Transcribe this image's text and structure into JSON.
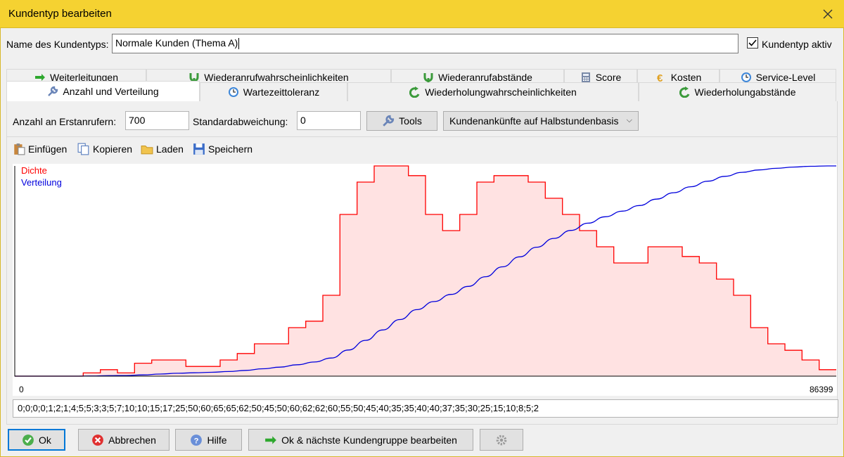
{
  "window": {
    "title": "Kundentyp bearbeiten"
  },
  "name_row": {
    "label": "Name des Kundentyps:",
    "value": "Normale Kunden (Thema A)",
    "active_label": "Kundentyp aktiv",
    "active_checked": true
  },
  "tabs_row1": [
    {
      "label": "Weiterleitungen",
      "icon": "arrow-right-icon"
    },
    {
      "label": "Wiederanrufwahrscheinlichkeiten",
      "icon": "recall-icon"
    },
    {
      "label": "Wiederanrufabstände",
      "icon": "recall-icon"
    },
    {
      "label": "Score",
      "icon": "calculator-icon"
    },
    {
      "label": "Kosten",
      "icon": "euro-icon"
    },
    {
      "label": "Service-Level",
      "icon": "clock-icon"
    }
  ],
  "tabs_row2": [
    {
      "label": "Anzahl und Verteilung",
      "icon": "wrench-icon",
      "active": true
    },
    {
      "label": "Wartezeittoleranz",
      "icon": "clock-icon"
    },
    {
      "label": "Wiederholungwahrscheinlichkeiten",
      "icon": "retry-icon"
    },
    {
      "label": "Wiederholungabstände",
      "icon": "retry-icon"
    }
  ],
  "toolbar": {
    "callers_label": "Anzahl an Erstanrufern:",
    "callers_value": "700",
    "std_label": "Standardabweichung:",
    "std_value": "0",
    "tools_label": "Tools",
    "mode_value": "Kundenankünfte auf Halbstundenbasis"
  },
  "iconbar": {
    "paste": "Einfügen",
    "copy": "Kopieren",
    "load": "Laden",
    "save": "Speichern"
  },
  "chart_data": {
    "type": "area",
    "legend": [
      "Dichte",
      "Verteilung"
    ],
    "x_min_label": "0",
    "x_max_label": "86399",
    "values": [
      0,
      0,
      0,
      0,
      1,
      2,
      1,
      4,
      5,
      5,
      3,
      3,
      5,
      7,
      10,
      10,
      15,
      17,
      25,
      50,
      60,
      65,
      65,
      62,
      50,
      45,
      50,
      60,
      62,
      62,
      60,
      55,
      50,
      45,
      40,
      35,
      35,
      40,
      40,
      37,
      35,
      30,
      25,
      15,
      10,
      8,
      5,
      2
    ],
    "series_colors": {
      "density": "#ff0000",
      "density_fill": "#ffe2e2",
      "distribution": "#0000dd"
    }
  },
  "values_text": "0;0;0;0;1;2;1;4;5;5;3;3;5;7;10;10;15;17;25;50;60;65;65;62;50;45;50;60;62;62;60;55;50;45;40;35;35;40;40;37;35;30;25;15;10;8;5;2",
  "buttons": {
    "ok": "Ok",
    "cancel": "Abbrechen",
    "help": "Hilfe",
    "next": "Ok & nächste Kundengruppe bearbeiten"
  }
}
